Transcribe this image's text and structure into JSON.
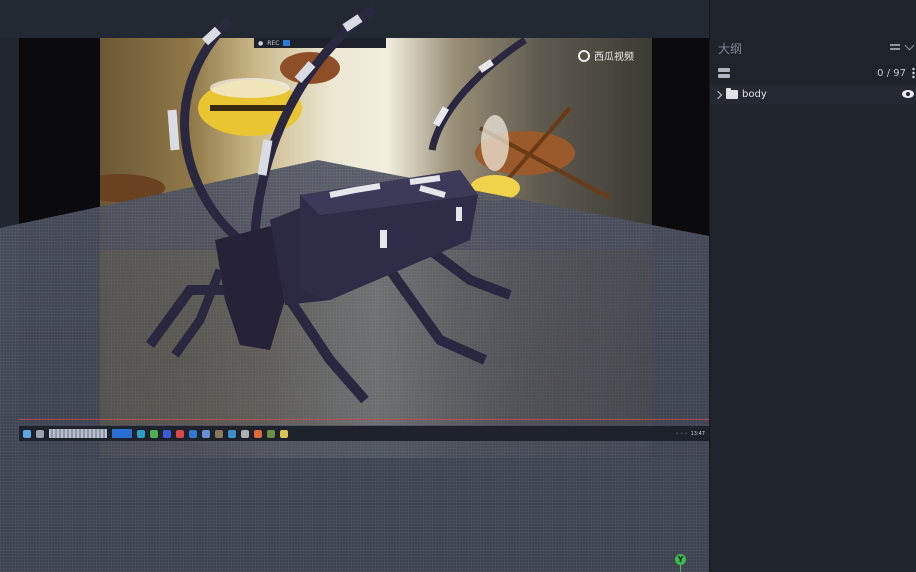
{
  "viewport": {
    "reference_image": {
      "watermark_text": "西瓜视频",
      "recorder_label": "REC"
    },
    "taskbar": {
      "icons": [
        "windows-icon",
        "search-icon",
        "task-view-icon",
        "browser-icon",
        "chrome-icon",
        "app-icon",
        "record-icon",
        "paint-icon",
        "blockbench-icon",
        "app-icon",
        "app-icon",
        "app-icon",
        "app-icon",
        "app-icon",
        "app-icon"
      ],
      "clock_label": "13:47"
    },
    "gizmo": {
      "y_label": "Y"
    }
  },
  "outliner": {
    "title": "大纲",
    "count": "0 / 97",
    "tree": [
      {
        "label": "body",
        "expanded": false,
        "visible": true
      }
    ]
  },
  "colors": {
    "accent": "#2b6fd1",
    "panel_bg": "#1f242b",
    "gizmo_y": "#3fb950"
  }
}
